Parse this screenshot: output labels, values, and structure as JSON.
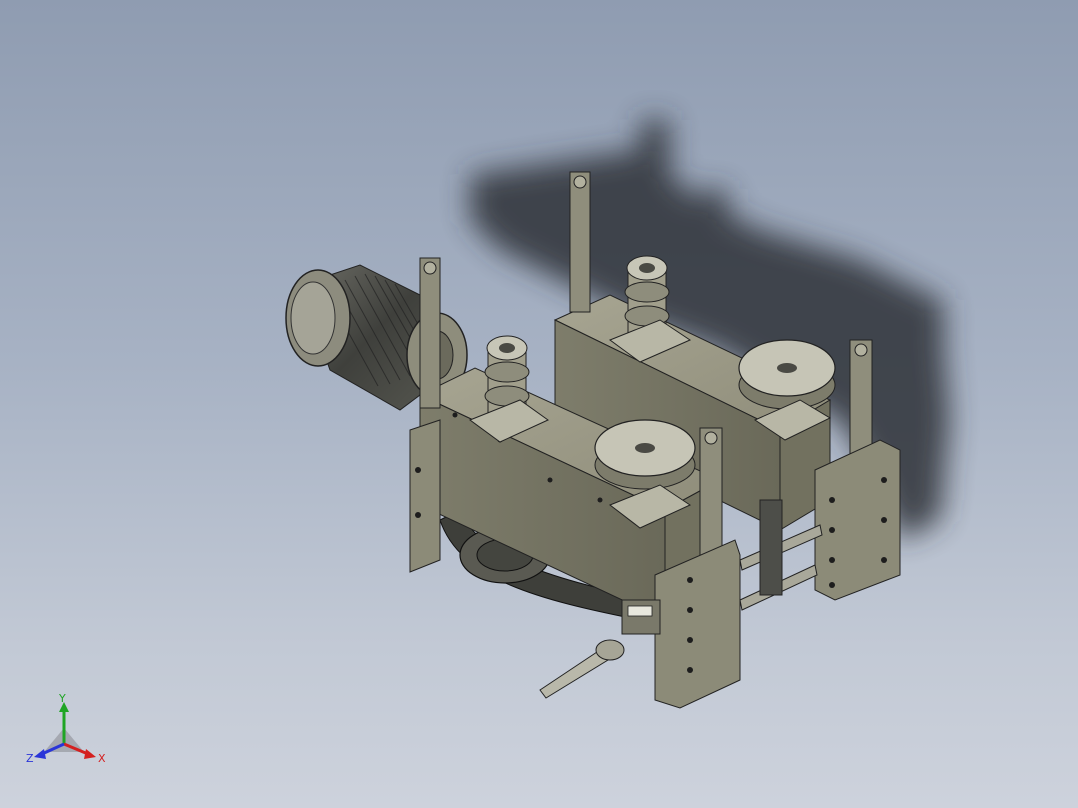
{
  "viewport": {
    "background_top": "#8f9cb1",
    "background_bottom": "#cdd2dc"
  },
  "model": {
    "body_color": "#8c8b78",
    "shadow_color": "#2d3038",
    "dark_part_color": "#4d4e49",
    "bolt_color": "#1d1d1d"
  },
  "triad": {
    "x_label": "X",
    "y_label": "Y",
    "z_label": "Z",
    "x_color": "#d42020",
    "y_color": "#1fa524",
    "z_color": "#2a35d8"
  }
}
